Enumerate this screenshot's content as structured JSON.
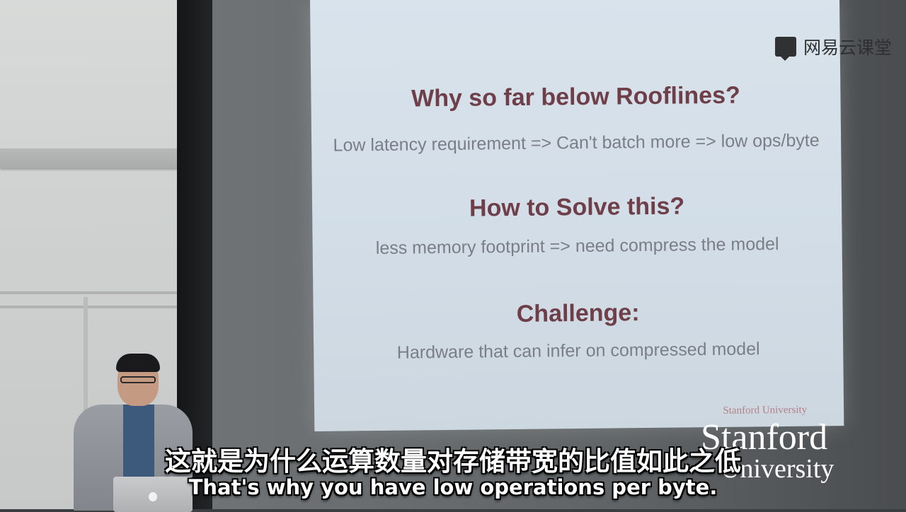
{
  "slide": {
    "heading_1": "Why so far below Rooflines?",
    "body_1": "Low latency requirement => Can't batch more => low ops/byte",
    "heading_2": "How to Solve this?",
    "body_2": "less memory footprint => need compress the model",
    "heading_3": "Challenge:",
    "body_3": "Hardware that can infer on compressed model",
    "footer": "Stanford University"
  },
  "watermark": {
    "text": "网易云课堂",
    "icon": "chat-bubble-icon"
  },
  "logo": {
    "line1": "Stanford",
    "line2": "University"
  },
  "subtitles": {
    "chinese": "这就是为什么运算数量对存储带宽的比值如此之低",
    "english": "That's why you have low operations per byte."
  },
  "colors": {
    "heading": "#6e3f48",
    "body_text": "#7a7e86",
    "slide_bg": "#d6e0ea",
    "subtitle": "#ffffff"
  }
}
